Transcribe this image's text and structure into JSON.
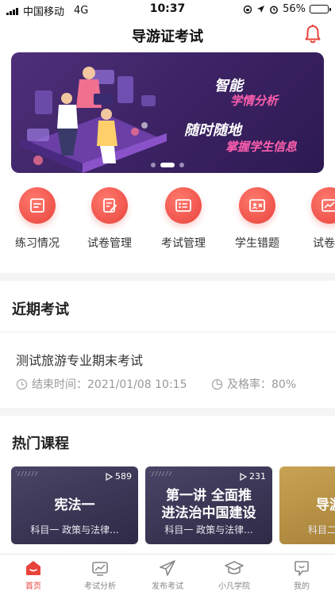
{
  "status_bar": {
    "carrier": "中国移动",
    "network": "4G",
    "time": "10:37",
    "battery": "56%",
    "battery_level": 0.56
  },
  "nav": {
    "title": "导游证考试"
  },
  "banner": {
    "line1": "智能",
    "line2": "学情分析",
    "line3": "随时随地",
    "line4": "掌握学生信息",
    "slides": 3,
    "active_slide": 1
  },
  "quick_entries": [
    {
      "label": "练习情况",
      "icon": "practice-icon"
    },
    {
      "label": "试卷管理",
      "icon": "paper-edit-icon"
    },
    {
      "label": "考试管理",
      "icon": "exam-list-icon"
    },
    {
      "label": "学生错题",
      "icon": "student-error-icon"
    },
    {
      "label": "试卷分",
      "icon": "paper-analysis-icon"
    }
  ],
  "recent_exams": {
    "title": "近期考试",
    "items": [
      {
        "name": "测试旅游专业期末考试",
        "end_time": "结束时间：2021/01/08 10:15",
        "pass_rate": "及格率：80%"
      }
    ]
  },
  "hot_courses": {
    "title": "热门课程",
    "items": [
      {
        "title": "宪法一",
        "subtitle": "科目一 政策与法律...",
        "plays": "589"
      },
      {
        "title_line1": "第一讲 全面推",
        "title_line2": "进法治中国建设",
        "subtitle": "科目一 政策与法律...",
        "plays": "231"
      },
      {
        "title": "导游",
        "subtitle": "科目二"
      }
    ]
  },
  "tab_bar": [
    {
      "label": "首页",
      "icon": "home-icon",
      "active": true
    },
    {
      "label": "考试分析",
      "icon": "chart-icon"
    },
    {
      "label": "发布考试",
      "icon": "send-icon"
    },
    {
      "label": "小凡学院",
      "icon": "graduation-cap-icon"
    },
    {
      "label": "我的",
      "icon": "profile-icon"
    }
  ],
  "colors": {
    "accent": "#e8433c",
    "banner_bg": "#3b2262",
    "banner_highlight": "#ff5fae",
    "course_dark": "#3a3556",
    "course_gold": "#b8913f"
  }
}
